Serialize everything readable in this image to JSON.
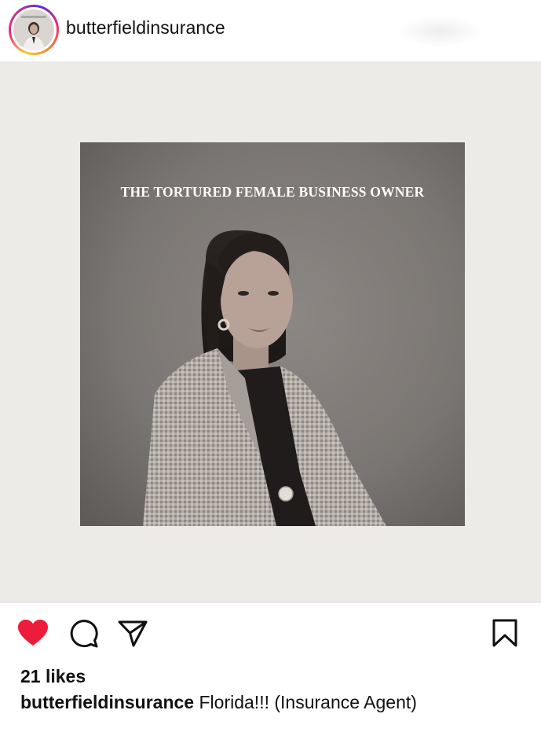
{
  "header": {
    "username": "butterfieldinsurance",
    "avatar_icon": "profile-photo"
  },
  "post": {
    "image_title": "THE TORTURED FEMALE BUSINESS OWNER",
    "liked": true
  },
  "actions": {
    "like_icon": "heart-icon",
    "comment_icon": "comment-icon",
    "share_icon": "send-icon",
    "save_icon": "bookmark-icon",
    "like_color": "#ed1c3c"
  },
  "stats": {
    "likes": "21 likes"
  },
  "caption": {
    "username": "butterfieldinsurance",
    "text": "Florida!!! (Insurance Agent)"
  }
}
